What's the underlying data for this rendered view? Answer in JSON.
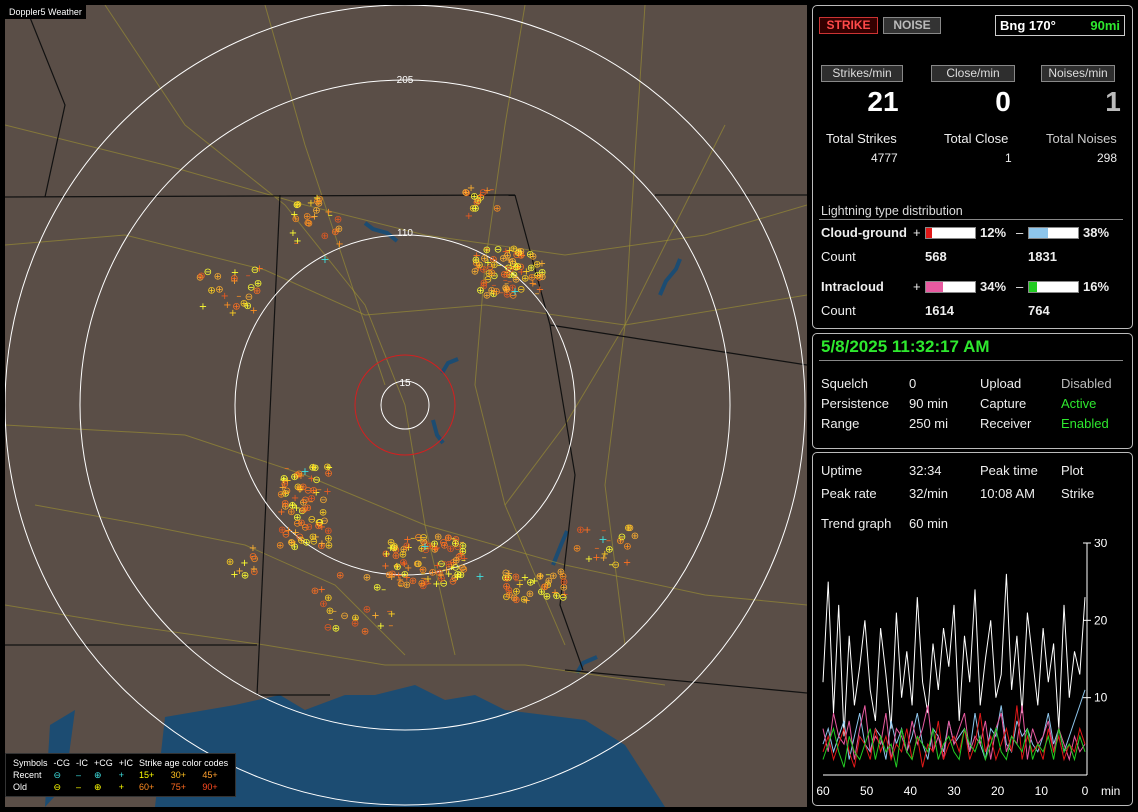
{
  "app": {
    "title": "Doppler5 Weather"
  },
  "map": {
    "range_labels": [
      "205",
      "110",
      "15"
    ],
    "colors": {
      "background": "#5a4e47",
      "water": "#1c4c72",
      "state_lines": "#111111",
      "roads": "#a89a30",
      "rings": "#ffffff",
      "close_ring": "#d32020"
    }
  },
  "legend": {
    "header": [
      "Symbols",
      "-CG",
      "-IC",
      "+CG",
      "+IC",
      "Strike age color codes"
    ],
    "recent_label": "Recent",
    "old_label": "Old",
    "recent_ages": [
      "15+",
      "30+",
      "45+"
    ],
    "old_ages": [
      "60+",
      "75+",
      "90+"
    ]
  },
  "status": {
    "strike_button": "STRIKE",
    "noise_button": "NOISE",
    "bearing": "Bng 170°",
    "range": "90mi",
    "rates": [
      {
        "label": "Strikes/min",
        "value": "21"
      },
      {
        "label": "Close/min",
        "value": "0"
      },
      {
        "label": "Noises/min",
        "value": "1"
      }
    ],
    "totals": [
      {
        "label": "Total Strikes",
        "value": "4777"
      },
      {
        "label": "Total Close",
        "value": "1"
      },
      {
        "label": "Total Noises",
        "value": "298"
      }
    ],
    "dist_title": "Lightning type distribution",
    "cloud_ground": {
      "label": "Cloud-ground",
      "plus_sign": "+",
      "minus_sign": "–",
      "plus_pct": "12%",
      "minus_pct": "38%",
      "plus_fill": 0.12,
      "minus_fill": 0.38,
      "plus_color": "#e01818",
      "minus_color": "#8ec6ec",
      "count_label": "Count",
      "plus_count": "568",
      "minus_count": "1831"
    },
    "intracloud": {
      "label": "Intracloud",
      "plus_sign": "+",
      "minus_sign": "–",
      "plus_pct": "34%",
      "minus_pct": "16%",
      "plus_fill": 0.34,
      "minus_fill": 0.16,
      "plus_color": "#e85aa0",
      "minus_color": "#22cc22",
      "count_label": "Count",
      "plus_count": "1614",
      "minus_count": "764"
    }
  },
  "settings": {
    "datetime": "5/8/2025 11:32:17 AM",
    "rows": [
      {
        "label": "Squelch",
        "value": "0",
        "label2": "Upload",
        "value2": "Disabled"
      },
      {
        "label": "Persistence",
        "value": "90 min",
        "label2": "Capture",
        "value2": "Active"
      },
      {
        "label": "Range",
        "value": "250 mi",
        "label2": "Receiver",
        "value2": "Enabled"
      }
    ]
  },
  "stats": {
    "uptime_label": "Uptime",
    "uptime": "32:34",
    "peak_time_label": "Peak time",
    "plot_label": "Plot",
    "peak_rate_label": "Peak rate",
    "peak_rate": "32/min",
    "peak_time": "10:08 AM",
    "plot": "Strike",
    "trend_label": "Trend graph",
    "trend": "60 min"
  },
  "chart_data": {
    "type": "line",
    "xlabel": "min",
    "x_ticks": [
      "60",
      "50",
      "40",
      "30",
      "20",
      "10",
      "0"
    ],
    "y_ticks": [
      "30",
      "20",
      "10"
    ],
    "xlim": [
      60,
      0
    ],
    "ylim": [
      0,
      30
    ],
    "series": [
      {
        "color": "#ffffff",
        "values": [
          12,
          25,
          8,
          22,
          5,
          18,
          9,
          14,
          20,
          11,
          7,
          19,
          13,
          6,
          21,
          10,
          16,
          9,
          23,
          12,
          8,
          17,
          11,
          19,
          14,
          22,
          7,
          18,
          12,
          24,
          9,
          15,
          20,
          10,
          13,
          26,
          11,
          18,
          8,
          21,
          15,
          9,
          19,
          12,
          17,
          6,
          22,
          10,
          16,
          13,
          23
        ]
      },
      {
        "color": "#8ec6ec",
        "values": [
          4,
          6,
          3,
          5,
          7,
          2,
          5,
          8,
          4,
          3,
          6,
          5,
          2,
          7,
          4,
          6,
          3,
          5,
          8,
          4,
          2,
          6,
          5,
          3,
          7,
          4,
          5,
          6,
          3,
          8,
          4,
          2,
          6,
          5,
          9,
          4,
          3,
          7,
          5,
          6,
          4,
          3,
          5,
          8,
          4,
          6,
          3,
          5,
          7,
          9,
          11
        ]
      },
      {
        "color": "#e85aa0",
        "values": [
          6,
          3,
          8,
          5,
          4,
          7,
          2,
          6,
          9,
          3,
          5,
          4,
          8,
          2,
          6,
          5,
          3,
          7,
          4,
          6,
          9,
          3,
          5,
          2,
          7,
          4,
          6,
          8,
          3,
          5,
          4,
          7,
          2,
          6,
          8,
          3,
          5,
          4,
          9,
          2,
          6,
          4,
          5,
          7,
          3,
          6,
          4,
          2,
          5,
          3,
          4
        ]
      },
      {
        "color": "#e01818",
        "values": [
          3,
          5,
          2,
          4,
          6,
          3,
          1,
          5,
          4,
          2,
          6,
          3,
          5,
          2,
          4,
          3,
          6,
          2,
          5,
          1,
          4,
          3,
          7,
          2,
          4,
          5,
          3,
          6,
          2,
          4,
          8,
          3,
          5,
          2,
          4,
          6,
          3,
          9,
          2,
          5,
          3,
          4,
          2,
          6,
          3,
          5,
          2,
          4,
          3,
          6,
          4
        ]
      },
      {
        "color": "#22cc22",
        "values": [
          2,
          4,
          6,
          3,
          1,
          5,
          3,
          2,
          4,
          6,
          2,
          5,
          3,
          4,
          1,
          6,
          3,
          2,
          5,
          4,
          3,
          6,
          2,
          4,
          5,
          3,
          2,
          6,
          4,
          3,
          5,
          2,
          4,
          6,
          3,
          2,
          5,
          4,
          3,
          6,
          2,
          4,
          3,
          5,
          2,
          6,
          3,
          4,
          2,
          5,
          3
        ]
      }
    ]
  }
}
